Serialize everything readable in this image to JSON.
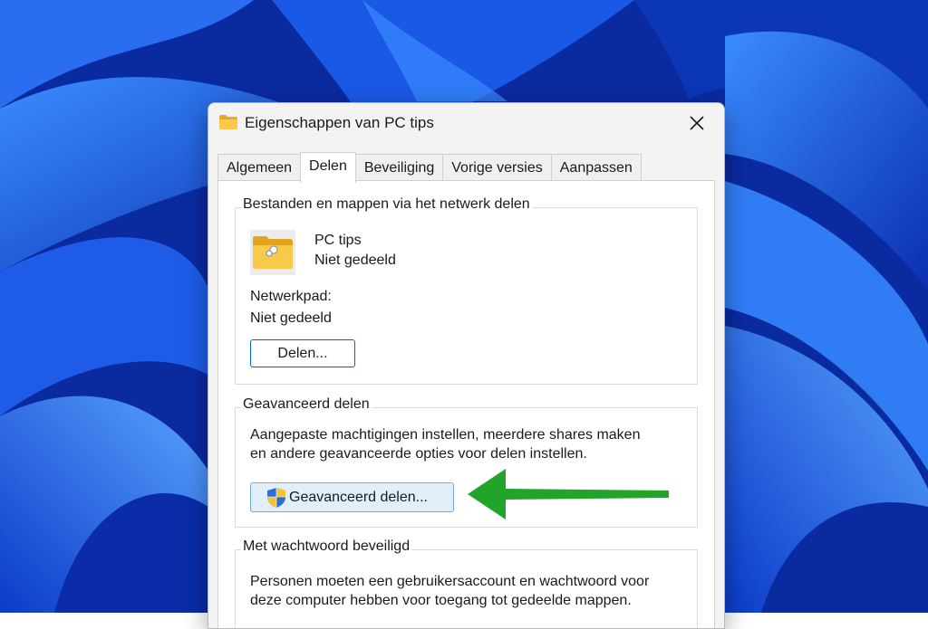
{
  "window": {
    "title": "Eigenschappen van PC tips"
  },
  "tabs": [
    {
      "label": "Algemeen"
    },
    {
      "label": "Delen"
    },
    {
      "label": "Beveiliging"
    },
    {
      "label": "Vorige versies"
    },
    {
      "label": "Aanpassen"
    }
  ],
  "network_share": {
    "legend": "Bestanden en mappen via het netwerk delen",
    "folder_name": "PC tips",
    "share_status": "Niet gedeeld",
    "path_label": "Netwerkpad:",
    "path_value": "Niet gedeeld",
    "share_button": "Delen..."
  },
  "advanced_share": {
    "legend": "Geavanceerd delen",
    "description_line1": "Aangepaste machtigingen instellen, meerdere shares maken",
    "description_line2": "en andere geavanceerde opties voor delen instellen.",
    "button": "Geavanceerd delen..."
  },
  "password_protect": {
    "legend": "Met wachtwoord beveiligd",
    "description_line1": "Personen moeten een gebruikersaccount en wachtwoord voor",
    "description_line2": "deze computer hebben voor toegang tot gedeelde mappen."
  },
  "colors": {
    "arrow": "#22a32a",
    "button_border": "#0067c0",
    "folder": "#f5c342"
  },
  "icons": {
    "title": "folder-icon",
    "close": "close-icon",
    "shared_folder": "shared-folder-icon",
    "uac": "uac-shield-icon",
    "annotation": "green-arrow-icon"
  }
}
